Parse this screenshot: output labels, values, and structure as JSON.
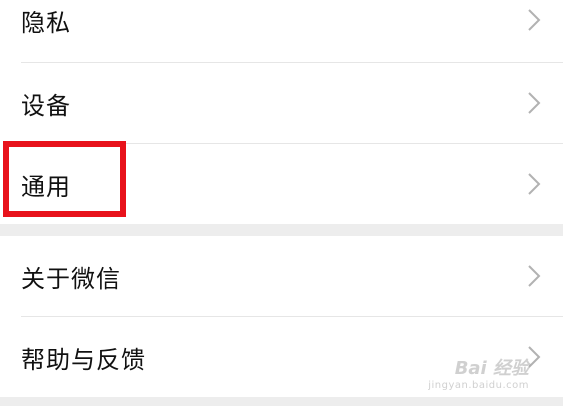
{
  "settings": {
    "items": [
      {
        "label": "隐私"
      },
      {
        "label": "设备"
      },
      {
        "label": "通用"
      },
      {
        "label": "关于微信"
      },
      {
        "label": "帮助与反馈"
      }
    ]
  },
  "icons": {
    "chevron": "chevron-right-icon"
  },
  "colors": {
    "highlight": "#e8121b",
    "background": "#ededed",
    "row": "#ffffff"
  },
  "watermark": {
    "brand": "Bai  经验",
    "url": "jingyan.baidu.com"
  }
}
